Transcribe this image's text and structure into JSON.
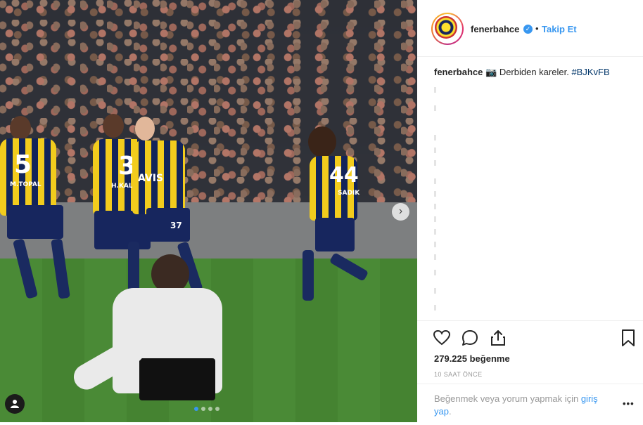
{
  "post": {
    "photo_alt_players": [
      "5",
      "3",
      "37",
      "44"
    ],
    "shirt_names": [
      "M.TOPAL",
      "H.KALO",
      "AVIS",
      "SADIK"
    ],
    "carousel": {
      "count": 4,
      "active_index": 0
    }
  },
  "header": {
    "username": "fenerbahce",
    "verified_icon": "verified-badge-icon",
    "separator": "•",
    "follow_label": "Takip Et"
  },
  "caption": {
    "username": "fenerbahce",
    "emoji_icon": "camera-emoji-icon",
    "text": "Derbiden kareler.",
    "hashtag": "#BJKvFB"
  },
  "actions": {
    "like_icon": "heart-icon",
    "comment_icon": "comment-icon",
    "share_icon": "share-icon",
    "save_icon": "bookmark-icon"
  },
  "likes": "279.225 beğenme",
  "timestamp": "10 SAAT ÖNCE",
  "comment_prompt": {
    "text": "Beğenmek veya yorum yapmak için",
    "link": "giriş yap",
    "suffix": "."
  },
  "colors": {
    "accent": "#3897f0",
    "kit_yellow": "#f2cc1d",
    "kit_navy": "#12245a",
    "pitch": "#4a8a36"
  }
}
